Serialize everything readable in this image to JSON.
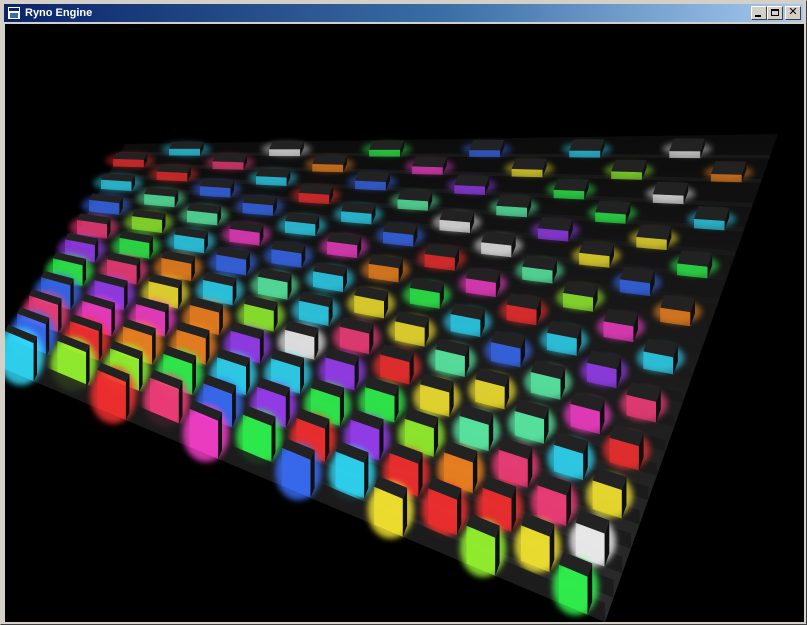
{
  "window": {
    "title": "Ryno Engine",
    "icon": "application-icon"
  },
  "controls": {
    "minimize_icon": "minimize-icon",
    "maximize_icon": "maximize-icon",
    "close_icon": "close-icon",
    "close_glyph": "✕"
  },
  "scene": {
    "background": "#000000",
    "light_colors": [
      "#ff3030",
      "#30ff50",
      "#3a70ff",
      "#ffee30",
      "#ff40d0",
      "#30e0ff",
      "#ffffff",
      "#ff8a20",
      "#a040ff",
      "#9aff30",
      "#ff4080",
      "#60ffb0"
    ]
  }
}
